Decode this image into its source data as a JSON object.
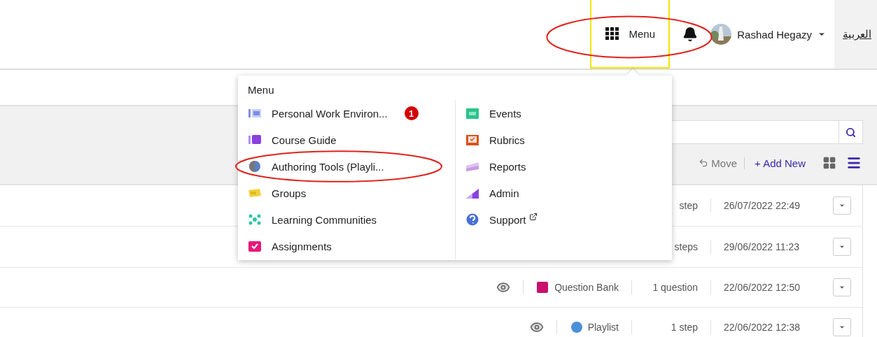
{
  "header": {
    "menu_button": {
      "label": "Menu",
      "circled": true,
      "outlined": true
    },
    "user": {
      "name": "Rashad Hegazy"
    },
    "language_link": "العربية"
  },
  "toolbar": {
    "move": "Move",
    "add_new": "+ Add New",
    "views": [
      {
        "kind": "grid",
        "selected": false
      },
      {
        "kind": "list",
        "selected": true
      }
    ]
  },
  "rows": [
    {
      "count": "step",
      "date": "26/07/2022 22:49"
    },
    {
      "count": "steps",
      "date": "29/06/2022 11:23"
    },
    {
      "type": "Question Bank",
      "count": "1 question",
      "date": "22/06/2022 12:50"
    },
    {
      "type": "Playlist",
      "count": "1 step",
      "date": "22/06/2022 12:38"
    }
  ],
  "menu": {
    "title": "Menu",
    "columns": [
      [
        {
          "label": "Personal Work Environ...",
          "badge": "1",
          "circled": false
        },
        {
          "label": "Course Guide",
          "circled": false
        },
        {
          "label": "Authoring Tools (Playli...",
          "circled": true
        },
        {
          "label": "Groups",
          "circled": false
        },
        {
          "label": "Learning Communities",
          "circled": false
        },
        {
          "label": "Assignments",
          "circled": false
        }
      ],
      [
        {
          "label": "Events",
          "circled": false
        },
        {
          "label": "Rubrics",
          "circled": false
        },
        {
          "label": "Reports",
          "circled": false
        },
        {
          "label": "Admin",
          "circled": false
        },
        {
          "label": "Support",
          "external": true,
          "circled": false
        }
      ]
    ]
  }
}
